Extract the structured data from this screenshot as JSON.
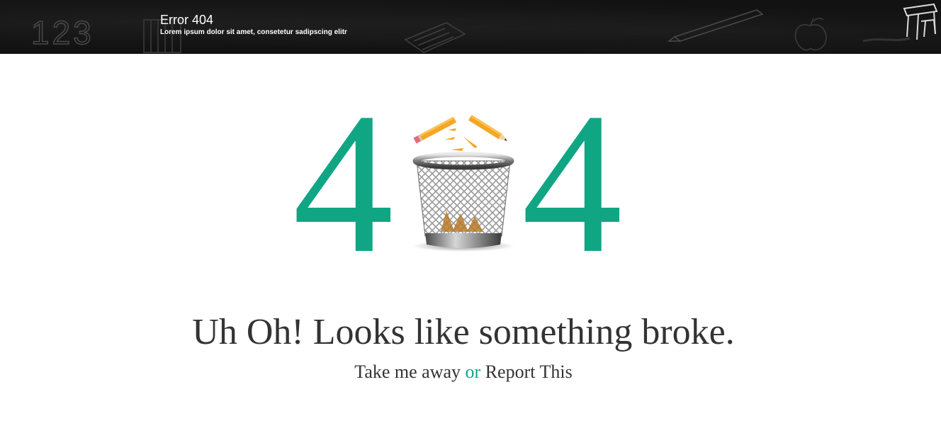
{
  "header": {
    "title": "Error 404",
    "subtitle": "Lorem ipsum dolor sit amet, consetetur sadipscing elitr",
    "doodle_text": "123"
  },
  "graphic": {
    "digit_left": "4",
    "digit_right": "4",
    "center_image": "trash-bin-with-broken-pencil"
  },
  "message": {
    "headline": "Uh Oh! Looks like something broke."
  },
  "links": {
    "primary": "Take me away",
    "separator": "or",
    "secondary": "Report This"
  },
  "colors": {
    "accent": "#10a684",
    "header_bg": "#121212",
    "text": "#333333",
    "pencil": "#f5a623"
  }
}
